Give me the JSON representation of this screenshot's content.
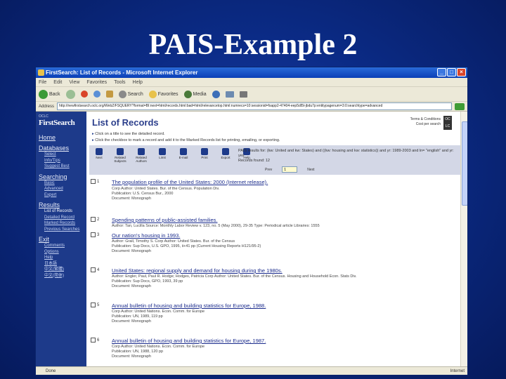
{
  "slide": {
    "title": "PAIS-Example 2"
  },
  "window": {
    "title": "FirstSearch: List of Records - Microsoft Internet Explorer",
    "buttons": [
      "_",
      "□",
      "×"
    ],
    "menu": [
      "File",
      "Edit",
      "View",
      "Favorites",
      "Tools",
      "Help"
    ],
    "toolbar": [
      "Back",
      "Search",
      "Favorites",
      "Media"
    ],
    "address_label": "Address",
    "address": "http://newfirstsearch.oclc.org/WebZ/FSQUERY?format=BI:next=html/records.html:bad=html/relevancetop.html:numrecs=10:sessionid=fsapp2-47404-eep5dl5t-jbdu7p:entitypagenum=3:0:searchtype=advanced",
    "status": "Done",
    "zone": "Internet"
  },
  "sidebar": {
    "oclc": "OCLC",
    "brand": "FirstSearch",
    "sections": [
      {
        "label": "Home",
        "items": []
      },
      {
        "label": "Databases",
        "items": [
          "Select",
          "Info/Tips",
          "Suggest Best"
        ]
      },
      {
        "label": "Searching",
        "items": [
          "Basic",
          "Advanced",
          "Expert"
        ]
      },
      {
        "label": "Results",
        "items": [
          "List of Records",
          "Detailed Record",
          "Marked Records",
          "Previous Searches"
        ]
      },
      {
        "label": "Exit",
        "items": [
          "Comments",
          "Options",
          "Help",
          "日本語",
          "中文(繁體)",
          "中文(简体)"
        ]
      }
    ]
  },
  "main": {
    "title": "List of Records",
    "terms": [
      "Terms & Conditions",
      "Cost per search"
    ],
    "oclc_badge": "OC LC",
    "instructions": [
      "Click on a title to see the detailed record.",
      "Click the checkbox to mark a record and add it to the Marked Records list for printing, emailing, or exporting."
    ],
    "tools": [
      "Next",
      "Related Subjects",
      "Related Authors",
      "Limit",
      "E-mail",
      "Print",
      "Export",
      "Help"
    ],
    "query": "PAIS results for: (kw: United and kw: States) and ((kw: housing and kw: statistics)) and yr: 1989-2003 and ln= \"english\" and yr: yes",
    "records_found": "Records found: 12",
    "pager": {
      "prev": "Prev",
      "page": "1",
      "next": "Next"
    }
  },
  "records": [
    {
      "num": "1",
      "title": "The population profile of the United States: 2000 (Internet release).",
      "lines": [
        "Corp Author: United States. Bur. of the Census. Population Div.",
        "Publication: U.S. Census Bur., 2000",
        "Document: Monograph"
      ]
    },
    {
      "num": "2",
      "title": "Spending patterns of public-assisted families.",
      "lines": [
        "Author: Tan, Lucilla Source: Monthly Labor Review v. 123, no. 5 (May 2000), 29-35  Type: Periodical article  Libraries: 1555"
      ]
    },
    {
      "num": "3",
      "title": "Our nation's housing in 1993.",
      "lines": [
        "Author: Grall, Timothy S. Corp Author: United States. Bur. of the Census",
        "Publication: Sup Docs, U.S. GPO, 1995, ii+41 pp (Current Housing Reports H121/95-2)",
        "Document: Monograph"
      ]
    },
    {
      "num": "4",
      "title": "United States: regional supply and demand for housing during the 1980s.",
      "lines": [
        "Author: Engler, Paul, Paul R. Hodge; Hodges, Patricia Corp Author: United States. Bur. of the Census. Housing and Household Econ. Stats Div.",
        "Publication: Sup Docs, GPO, 1993, 39 pp",
        "Document: Monograph"
      ]
    },
    {
      "num": "5",
      "title": "Annual bulletin of housing and building statistics for Europe, 1988.",
      "lines": [
        "Corp Author: United Nations. Econ. Comm. for Europe",
        "Publication: UN, 1989, 119 pp",
        "Document: Monograph"
      ]
    },
    {
      "num": "6",
      "title": "Annual bulletin of housing and building statistics for Europe, 1987.",
      "lines": [
        "Corp Author: United Nations. Econ. Comm. for Europe",
        "Publication: UN, 1988, 120 pp",
        "Document: Monograph"
      ]
    }
  ]
}
